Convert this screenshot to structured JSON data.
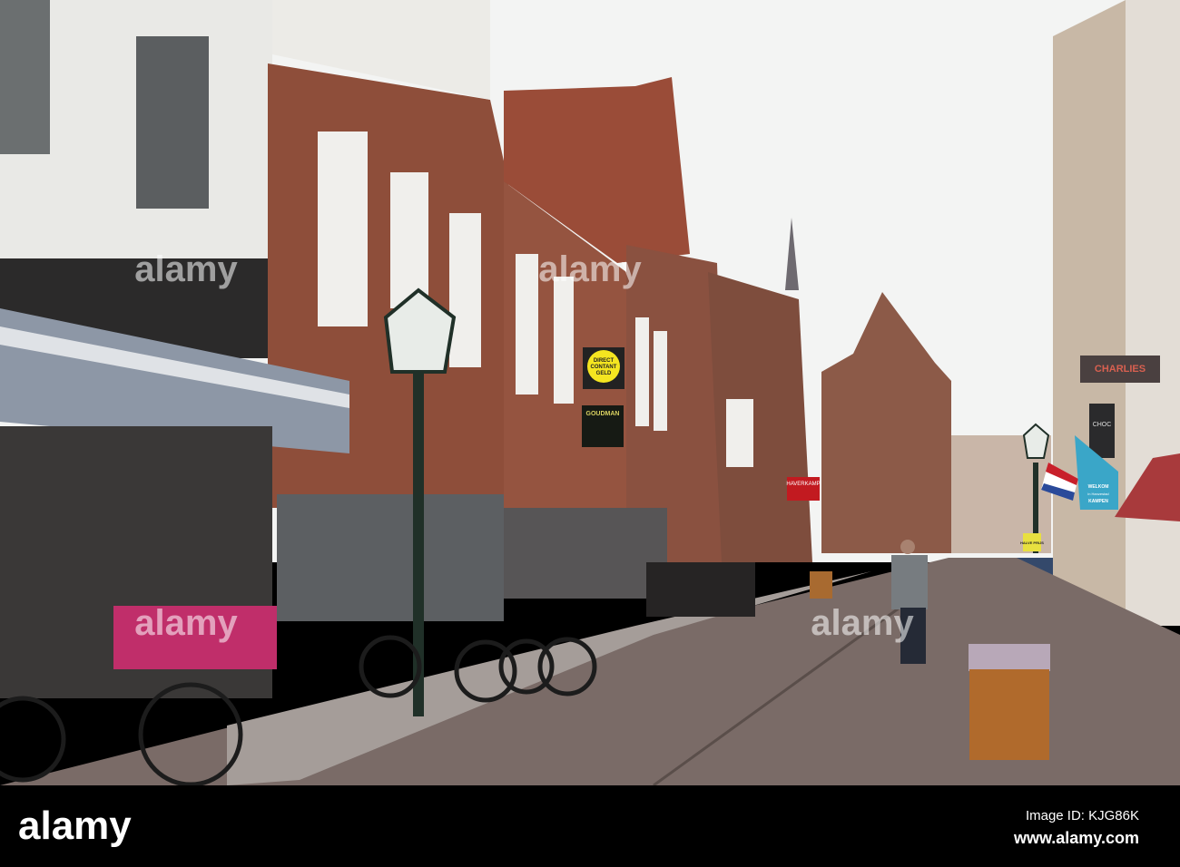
{
  "watermark": {
    "text": "alamy"
  },
  "footer": {
    "logo": "alamy",
    "image_id": "Image ID: KJG86K",
    "url": "www.alamy.com"
  },
  "signs": {
    "direct_contant": [
      "DIRECT",
      "CONTANT",
      "GELD"
    ],
    "goudman": "GOUDMAN",
    "haverkamp": "HAVERKAMP",
    "charlies": "CHARLIES",
    "choc": "CHOC",
    "welkom_flag": [
      "WELKOM",
      "in Hanzestad",
      "KAMPEN"
    ],
    "halve_prijs": "HALVE PRIJS"
  },
  "colors": {
    "sky": "#f4f5f4",
    "brick": "#8a4a38",
    "pavement": "#7a6a66",
    "flag_blue": "#3aa6c8",
    "sign_red": "#c21a20"
  }
}
